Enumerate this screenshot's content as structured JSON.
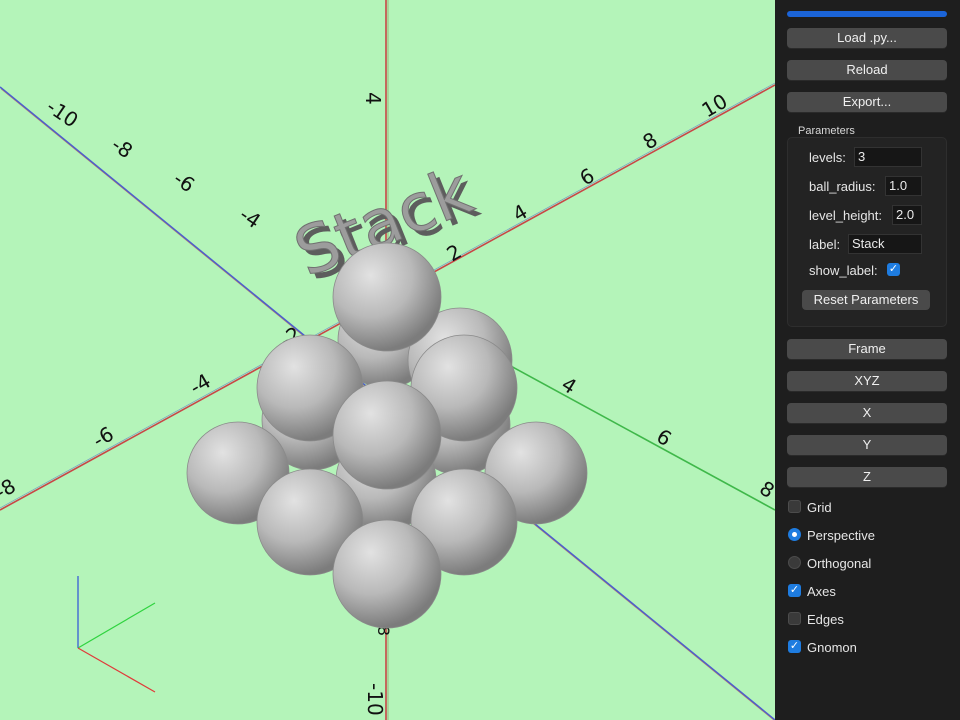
{
  "viewport": {
    "background": "#b4f4b9",
    "model_label": "Stack",
    "axis_ticks": {
      "x_negative": [
        "-10",
        "-8",
        "-6",
        "-4"
      ],
      "x_positive": [
        "2",
        "4",
        "6",
        "8",
        "10"
      ],
      "y_negative": [
        "-2",
        "-4",
        "-6",
        "-8"
      ],
      "y_positive": [
        "2",
        "4",
        "6",
        "8"
      ],
      "z": [
        "4",
        "-8",
        "-10"
      ]
    }
  },
  "panel": {
    "buttons": {
      "load": "Load .py...",
      "reload": "Reload",
      "export": "Export..."
    },
    "parameters": {
      "title": "Parameters",
      "levels": {
        "label": "levels:",
        "value": "3"
      },
      "ball_radius": {
        "label": "ball_radius:",
        "value": "1.0"
      },
      "level_height": {
        "label": "level_height:",
        "value": "2.0"
      },
      "label": {
        "label": "label:",
        "value": "Stack"
      },
      "show_label": {
        "label": "show_label:",
        "checked": true
      },
      "reset": "Reset Parameters"
    },
    "view_buttons": {
      "frame": "Frame",
      "xyz": "XYZ",
      "x": "X",
      "y": "Y",
      "z": "Z"
    },
    "options": {
      "grid": {
        "label": "Grid",
        "checked": false
      },
      "perspective": {
        "label": "Perspective",
        "selected": true
      },
      "orthogonal": {
        "label": "Orthogonal",
        "selected": false
      },
      "axes": {
        "label": "Axes",
        "checked": true
      },
      "edges": {
        "label": "Edges",
        "checked": false
      },
      "gnomon": {
        "label": "Gnomon",
        "checked": true
      }
    },
    "accent_color": "#1e7ce0"
  }
}
